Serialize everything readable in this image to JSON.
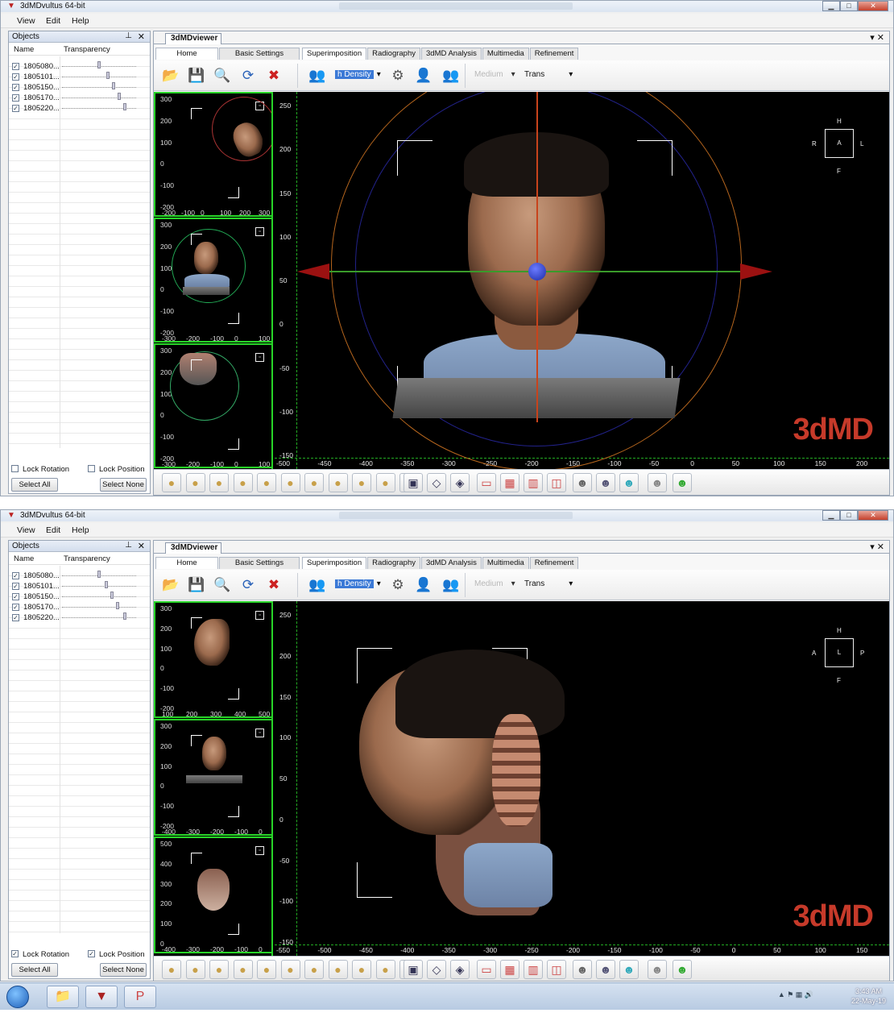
{
  "windows": [
    {
      "title": "3dMDvultus 64-bit",
      "menu": [
        "View",
        "Edit",
        "Help"
      ],
      "objects_panel": {
        "title": "Objects",
        "columns": [
          "Name",
          "Transparency"
        ],
        "items": [
          {
            "name": "1805080...",
            "checked": true,
            "transparency": 0.5
          },
          {
            "name": "1805101...",
            "checked": true,
            "transparency": 0.62
          },
          {
            "name": "1805150...",
            "checked": true,
            "transparency": 0.7
          },
          {
            "name": "1805170...",
            "checked": true,
            "transparency": 0.78
          },
          {
            "name": "1805220...",
            "checked": true,
            "transparency": 0.86
          }
        ],
        "lock_rotation": {
          "label": "Lock Rotation",
          "checked": false
        },
        "lock_position": {
          "label": "Lock Position",
          "checked": false
        },
        "select_all": "Select All",
        "select_none": "Select None"
      },
      "viewer": {
        "doc_tab": "3dMDviewer",
        "sub_tabs": [
          "Home",
          "Basic Settings"
        ],
        "tool_tabs": [
          "Superimposition",
          "Radiography",
          "3dMD Analysis",
          "Multimedia",
          "Refinement"
        ],
        "density_value": "h Density",
        "quality_value": "Medium",
        "trans_value": "Trans",
        "thumb_views": [
          {
            "y_labels": [
              "300",
              "200",
              "100",
              "0",
              "-100",
              "-200"
            ],
            "x_labels": [
              "-200",
              "-100",
              "0",
              "100",
              "200",
              "300"
            ]
          },
          {
            "y_labels": [
              "300",
              "200",
              "100",
              "0",
              "-100",
              "-200"
            ],
            "x_labels": [
              "-300",
              "-200",
              "-100",
              "0",
              "100"
            ]
          },
          {
            "y_labels": [
              "300",
              "200",
              "100",
              "0",
              "-100",
              "-200"
            ],
            "x_labels": [
              "-300",
              "-200",
              "-100",
              "0",
              "100"
            ]
          }
        ],
        "main_y_labels": [
          "250",
          "200",
          "150",
          "100",
          "50",
          "0",
          "-50",
          "-100",
          "-150"
        ],
        "main_x_labels": [
          "-500",
          "-450",
          "-400",
          "-350",
          "-300",
          "-250",
          "-200",
          "-150",
          "-100",
          "-50",
          "0",
          "50",
          "100",
          "150",
          "200"
        ],
        "orientation": {
          "center": "A",
          "top": "H",
          "bottom": "F",
          "left": "R",
          "right": "L"
        },
        "brand": "3dMD"
      }
    },
    {
      "title": "3dMDvultus 64-bit",
      "menu": [
        "View",
        "Edit",
        "Help"
      ],
      "objects_panel": {
        "title": "Objects",
        "columns": [
          "Name",
          "Transparency"
        ],
        "items": [
          {
            "name": "1805080...",
            "checked": true,
            "transparency": 0.5
          },
          {
            "name": "1805101...",
            "checked": true,
            "transparency": 0.6
          },
          {
            "name": "1805150...",
            "checked": true,
            "transparency": 0.68
          },
          {
            "name": "1805170...",
            "checked": true,
            "transparency": 0.76
          },
          {
            "name": "1805220...",
            "checked": true,
            "transparency": 0.86
          }
        ],
        "lock_rotation": {
          "label": "Lock Rotation",
          "checked": true
        },
        "lock_position": {
          "label": "Lock Position",
          "checked": true
        },
        "select_all": "Select All",
        "select_none": "Select None"
      },
      "viewer": {
        "doc_tab": "3dMDviewer",
        "sub_tabs": [
          "Home",
          "Basic Settings"
        ],
        "tool_tabs": [
          "Superimposition",
          "Radiography",
          "3dMD Analysis",
          "Multimedia",
          "Refinement"
        ],
        "density_value": "h Density",
        "quality_value": "Medium",
        "trans_value": "Trans",
        "thumb_views": [
          {
            "y_labels": [
              "300",
              "200",
              "100",
              "0",
              "-100",
              "-200"
            ],
            "x_labels": [
              "100",
              "200",
              "300",
              "400",
              "500"
            ]
          },
          {
            "y_labels": [
              "300",
              "200",
              "100",
              "0",
              "-100",
              "-200"
            ],
            "x_labels": [
              "-400",
              "-300",
              "-200",
              "-100",
              "0"
            ]
          },
          {
            "y_labels": [
              "500",
              "400",
              "300",
              "200",
              "100",
              "0"
            ],
            "x_labels": [
              "-400",
              "-300",
              "-200",
              "-100",
              "0"
            ]
          }
        ],
        "main_y_labels": [
          "250",
          "200",
          "150",
          "100",
          "50",
          "0",
          "-50",
          "-100",
          "-150"
        ],
        "main_x_labels": [
          "-550",
          "-500",
          "-450",
          "-400",
          "-350",
          "-300",
          "-250",
          "-200",
          "-150",
          "-100",
          "-50",
          "0",
          "50",
          "100",
          "150"
        ],
        "orientation": {
          "center": "L",
          "top": "H",
          "bottom": "F",
          "left": "A",
          "right": "P"
        },
        "brand": "3dMD"
      }
    }
  ],
  "taskbar": {
    "time": "3:43 AM",
    "date": "22-May-19"
  }
}
